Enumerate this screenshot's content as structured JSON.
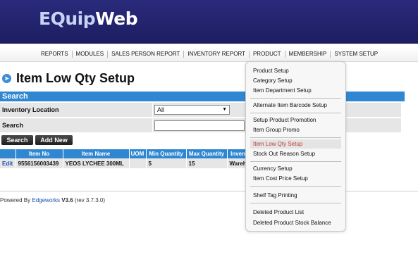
{
  "header": {
    "logo_part1": "EQuip",
    "logo_part2": "Web"
  },
  "nav": {
    "items": [
      "REPORTS",
      "MODULES",
      "SALES PERSON REPORT",
      "INVENTORY REPORT",
      "PRODUCT",
      "MEMBERSHIP",
      "SYSTEM SETUP"
    ]
  },
  "page": {
    "title_icon": "arrow-right-circle-icon",
    "title": "Item Low Qty Setup",
    "section": "Search"
  },
  "form": {
    "location_label": "Inventory Location",
    "location_value": "All",
    "search_label": "Search",
    "search_value": ""
  },
  "buttons": {
    "search": "Search",
    "add_new": "Add New"
  },
  "table": {
    "columns": [
      "",
      "Item No",
      "Item Name",
      "UOM",
      "Min Quantity",
      "Max Quantity",
      "Inven"
    ],
    "rows": [
      {
        "action": "Edit",
        "item_no": "9556156003439",
        "item_name": "YEOS LYCHEE 300ML",
        "uom": "",
        "min": "5",
        "max": "15",
        "inventory": "Wareh"
      }
    ]
  },
  "footer": {
    "prefix": "Powered By",
    "company": "Edgeworks",
    "version": "V3.6",
    "revision": "(rev 3.7.3.0)"
  },
  "product_menu": {
    "items": [
      "Product Setup",
      "Category Setup",
      "Item Department Setup",
      "Alternate Item Barcode Setup",
      "Setup Product Promotion",
      "Item Group Promo",
      "Item Low Qty Setup",
      "Stock Out Reason Setup",
      "Currency Setup",
      "Item Cost Price Setup",
      "Shelf Tag Printing",
      "Deleted Product List",
      "Deleted Product Stock Balance"
    ],
    "active": "Item Low Qty Setup"
  },
  "colors": {
    "header": "#23236e",
    "accent": "#2f87d2",
    "link": "#1a4fb3",
    "active_menu_text": "#c0392b"
  }
}
